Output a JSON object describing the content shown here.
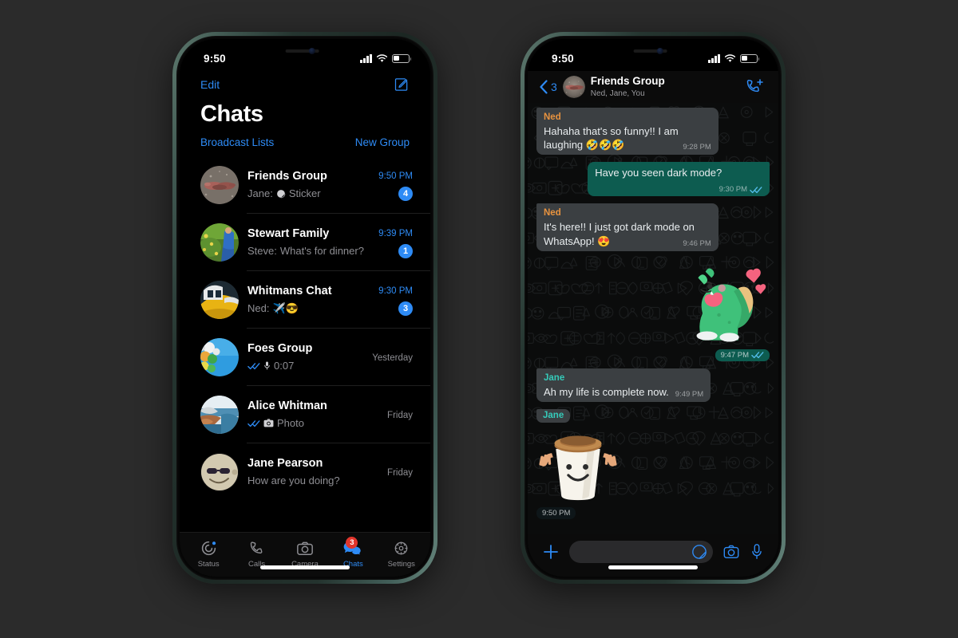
{
  "theme": {
    "page_background": "#2b2b2b",
    "accent_blue": "#2e8bf5",
    "bubble_in": "#3b3f42",
    "bubble_out": "#0d5c50",
    "badge_blue": "#2e8bf5",
    "badge_red": "#e0352c",
    "sender_ned": "#e8933f",
    "sender_jane": "#35cbba",
    "screen_black": "#000000",
    "frame_midnight_green": "#24332e"
  },
  "left_phone": {
    "status_bar": {
      "time": "9:50",
      "signal": "cellular-bars-icon",
      "wifi": "wifi-icon",
      "battery": "battery-icon"
    },
    "nav": {
      "edit_label": "Edit",
      "compose_icon": "compose-icon"
    },
    "page_title": "Chats",
    "sub_actions": {
      "broadcast_label": "Broadcast Lists",
      "new_group_label": "New Group"
    },
    "chats": [
      {
        "name": "Friends Group",
        "preview_prefix": "Jane:",
        "preview": "Sticker",
        "preview_icon": "sticker-icon",
        "time": "9:50 PM",
        "time_unread": true,
        "badge": "4",
        "avatar": "crab-photo"
      },
      {
        "name": "Stewart Family",
        "preview_prefix": "Steve:",
        "preview": "What's for dinner?",
        "preview_icon": "",
        "time": "9:39 PM",
        "time_unread": true,
        "badge": "1",
        "avatar": "garden-photo"
      },
      {
        "name": "Whitmans Chat",
        "preview_prefix": "Ned:",
        "preview": "✈️😎",
        "preview_icon": "",
        "time": "9:30 PM",
        "time_unread": true,
        "badge": "3",
        "avatar": "boat-photo"
      },
      {
        "name": "Foes Group",
        "preview_prefix": "",
        "preview": "0:07",
        "preview_icon": "mic-icon",
        "time": "Yesterday",
        "time_unread": false,
        "badge": "",
        "avatar": "balloons-photo",
        "read_ticks": true
      },
      {
        "name": "Alice Whitman",
        "preview_prefix": "",
        "preview": "Photo",
        "preview_icon": "camera-icon",
        "time": "Friday",
        "time_unread": false,
        "badge": "",
        "avatar": "beach-photo",
        "read_ticks": true
      },
      {
        "name": "Jane Pearson",
        "preview_prefix": "",
        "preview": "How are you doing?",
        "preview_icon": "",
        "time": "Friday",
        "time_unread": false,
        "badge": "",
        "avatar": "smiley-photo"
      }
    ],
    "tabs": [
      {
        "label": "Status",
        "icon": "status-icon",
        "active": false,
        "badge": ""
      },
      {
        "label": "Calls",
        "icon": "phone-icon",
        "active": false,
        "badge": ""
      },
      {
        "label": "Camera",
        "icon": "camera-icon",
        "active": false,
        "badge": ""
      },
      {
        "label": "Chats",
        "icon": "chats-icon",
        "active": true,
        "badge": "3"
      },
      {
        "label": "Settings",
        "icon": "gear-icon",
        "active": false,
        "badge": ""
      }
    ]
  },
  "right_phone": {
    "status_bar": {
      "time": "9:50",
      "signal": "cellular-bars-icon",
      "wifi": "wifi-icon",
      "battery": "battery-icon"
    },
    "header": {
      "back_icon": "chevron-left-icon",
      "back_count": "3",
      "avatar": "crab-photo",
      "title": "Friends Group",
      "members": "Ned, Jane, You",
      "call_icon": "add-call-icon"
    },
    "messages": [
      {
        "kind": "text",
        "side": "in",
        "sender": "Ned",
        "sender_color": "ned",
        "text": "Hahaha that's so funny!! I am laughing 🤣🤣🤣",
        "time": "9:28 PM",
        "ticks": false
      },
      {
        "kind": "text",
        "side": "out",
        "sender": "",
        "sender_color": "",
        "text": "Have you seen dark mode?",
        "time": "9:30 PM",
        "ticks": true
      },
      {
        "kind": "text",
        "side": "in",
        "sender": "Ned",
        "sender_color": "ned",
        "text": "It's here!! I just got dark mode on WhatsApp! 😍",
        "time": "9:46 PM",
        "ticks": false
      },
      {
        "kind": "sticker",
        "side": "out",
        "sender": "",
        "sender_color": "",
        "sticker": "dinosaur-heart-sticker",
        "time": "9:47 PM",
        "ticks": true
      },
      {
        "kind": "text",
        "side": "in",
        "sender": "Jane",
        "sender_color": "jane",
        "text": "Ah my life is complete now.",
        "time": "9:49 PM",
        "ticks": false
      },
      {
        "kind": "sticker",
        "side": "in",
        "sender": "Jane",
        "sender_color": "jane",
        "sticker": "coffee-cup-sticker",
        "time": "9:50 PM",
        "ticks": false
      }
    ],
    "composer": {
      "plus_icon": "plus-icon",
      "input_placeholder": "",
      "input_value": "",
      "sticker_icon": "sticker-icon",
      "camera_icon": "camera-icon",
      "mic_icon": "mic-icon"
    }
  }
}
